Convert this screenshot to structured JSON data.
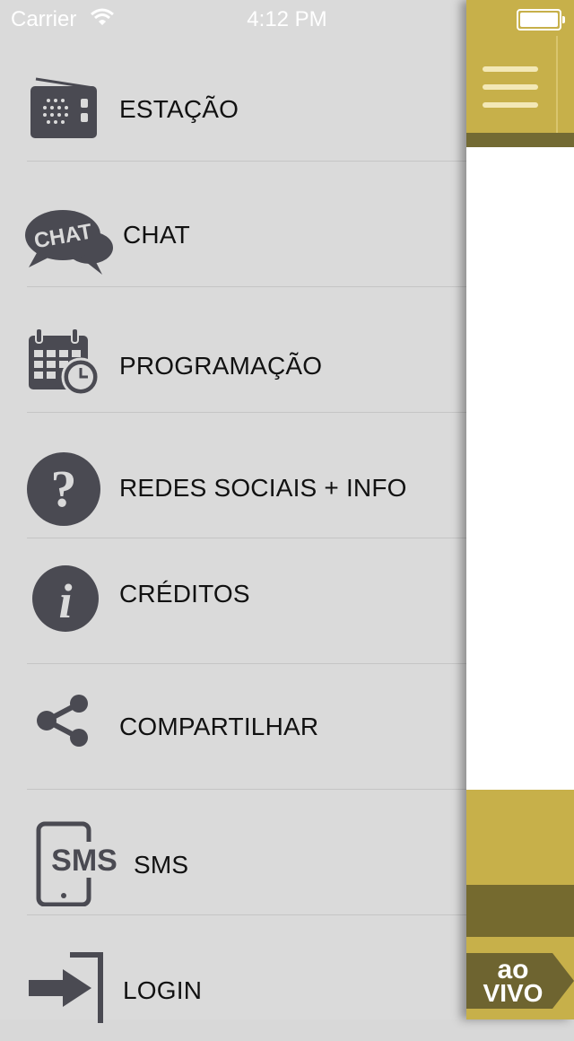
{
  "status_bar": {
    "carrier": "Carrier",
    "time": "4:12 PM"
  },
  "menu": {
    "items": [
      {
        "label": "ESTAÇÃO",
        "icon": "radio-icon"
      },
      {
        "label": "CHAT",
        "icon": "chat-bubble-icon",
        "icon_text": "CHAT"
      },
      {
        "label": "PROGRAMAÇÃO",
        "icon": "calendar-clock-icon"
      },
      {
        "label": "REDES SOCIAIS + INFO",
        "icon": "question-icon",
        "icon_text": "?"
      },
      {
        "label": "CRÉDITOS",
        "icon": "info-icon",
        "icon_text": "i"
      },
      {
        "label": "COMPARTILHAR",
        "icon": "share-icon"
      },
      {
        "label": "SMS",
        "icon": "sms-phone-icon",
        "icon_text": "SMS"
      },
      {
        "label": "LOGIN",
        "icon": "login-arrow-icon"
      }
    ]
  },
  "panel": {
    "live_badge": {
      "line1": "ao",
      "line2": "VIVO"
    }
  },
  "colors": {
    "accent_gold": "#c7b04a",
    "accent_dark": "#736a33",
    "icon_gray": "#4a4a52"
  }
}
